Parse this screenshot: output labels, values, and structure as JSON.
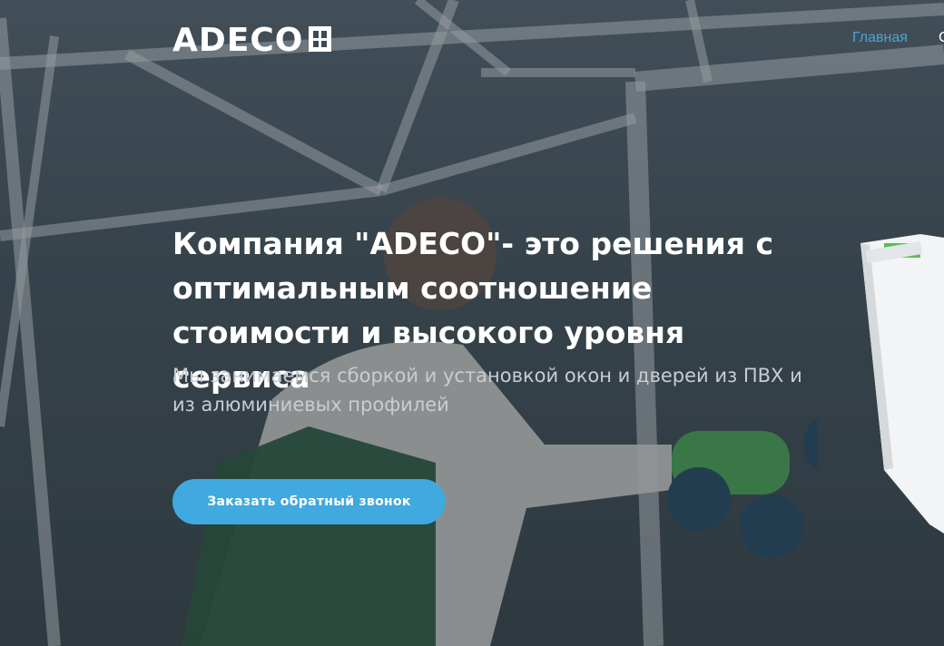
{
  "header": {
    "logo_text": "ADECO",
    "nav": {
      "home_label": "Главная",
      "next_label_partial": "С"
    }
  },
  "hero": {
    "headline": "Компания \"ADECO\"- это решения с оптимальным соотношение стоимости и высокого уровня сервиса",
    "subtext": "Мы занимаемся сборкой и установкой окон и дверей из ПВХ и из алюминиевых профилей",
    "cta_label": "Заказать обратный звонок"
  },
  "colors": {
    "accent": "#3fa9e0",
    "nav_link": "#47a6d9",
    "headline": "#ffffff",
    "subtext": "#c8cdd1"
  },
  "icons": [
    "window-profile-image",
    "worker-photo"
  ]
}
